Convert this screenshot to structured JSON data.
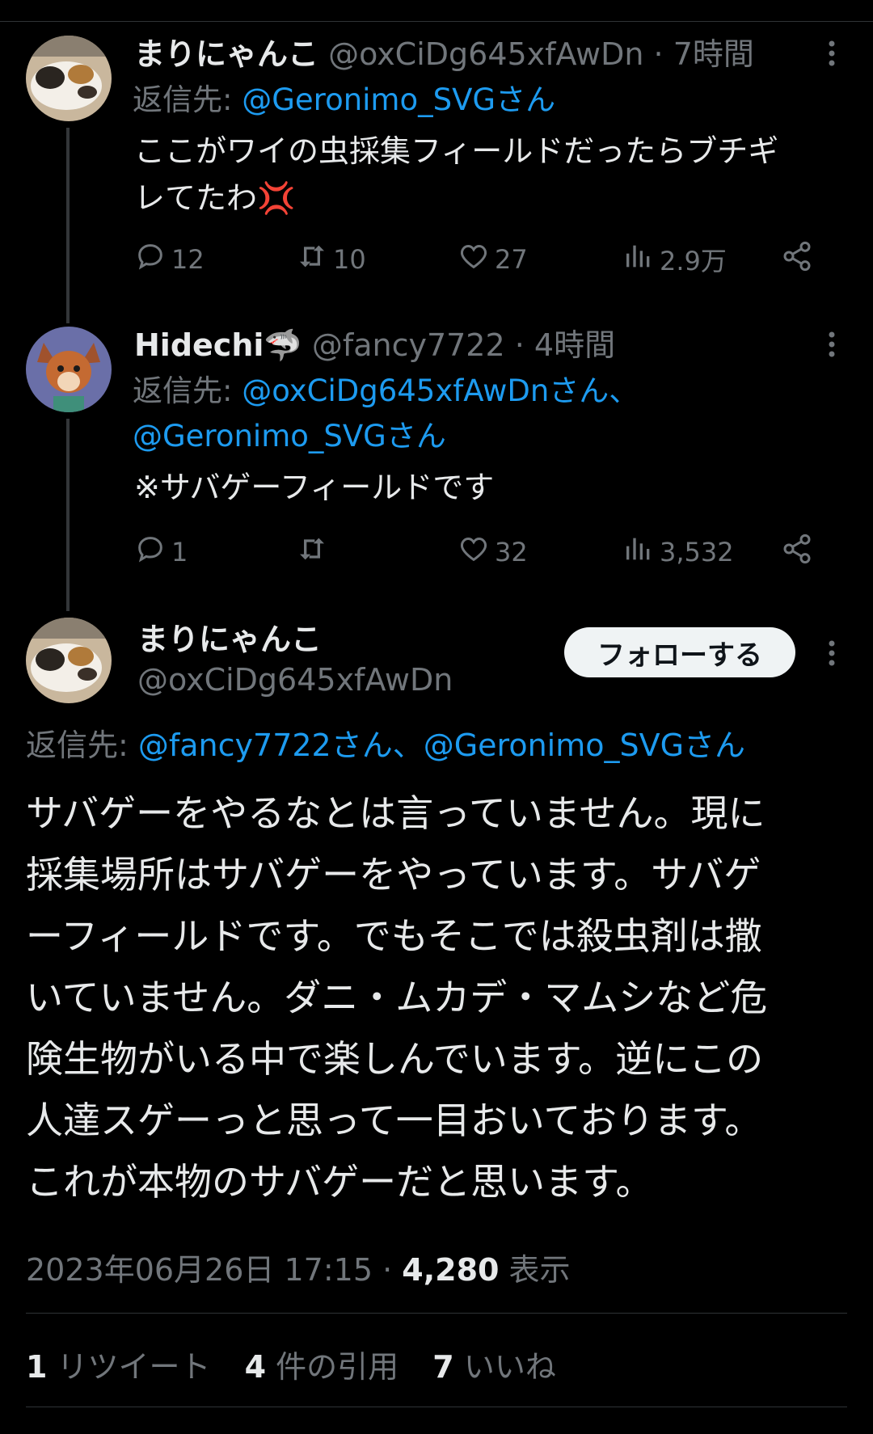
{
  "tweets": [
    {
      "name": "まりにゃんこ",
      "handle": "@oxCiDg645xfAwDn",
      "time": "· 7時間",
      "reply_prefix": "返信先: ",
      "reply_line1": "@Geronimo_SVGさん",
      "reply_line2": "",
      "text_line1": "ここがワイの虫採集フィールドだったらブチギ",
      "text_line2": "レてたわ💢",
      "replies": "12",
      "retweets": "10",
      "likes": "27",
      "views": "2.9万"
    },
    {
      "name": "Hidechi🦈",
      "handle": "@fancy7722",
      "time": "· 4時間",
      "reply_prefix": "返信先: ",
      "reply_line1": "@oxCiDg645xfAwDnさん、",
      "reply_line2": "@Geronimo_SVGさん",
      "text_line1": "※サバゲーフィールドです",
      "replies": "1",
      "retweets": "",
      "likes": "32",
      "views": "3,532"
    }
  ],
  "main": {
    "name": "まりにゃんこ",
    "handle": "@oxCiDg645xfAwDn",
    "follow_label": "フォローする",
    "reply_prefix": "返信先: ",
    "reply_to": "@fancy7722さん、@Geronimo_SVGさん",
    "text_lines": [
      "サバゲーをやるなとは言っていません。現に",
      "採集場所はサバゲーをやっています。サバゲ",
      "ーフィールドです。でもそこでは殺虫剤は撒",
      "いていません。ダニ・ムカデ・マムシなど危",
      "険生物がいる中で楽しんでいます。逆にこの",
      "人達スゲーっと思って一目おいております。",
      "これが本物のサバゲーだと思います。"
    ],
    "timestamp": "2023年06月26日 17:15 · ",
    "views_count": "4,280",
    "views_label": " 表示",
    "stats": {
      "retweets_count": "1",
      "retweets_label": " リツイート",
      "quotes_count": "4",
      "quotes_label": " 件の引用",
      "likes_count": "7",
      "likes_label": " いいね"
    }
  },
  "colors": {
    "background": "#000000",
    "text": "#e7e9ea",
    "muted": "#71767b",
    "link": "#1d9bf0"
  }
}
